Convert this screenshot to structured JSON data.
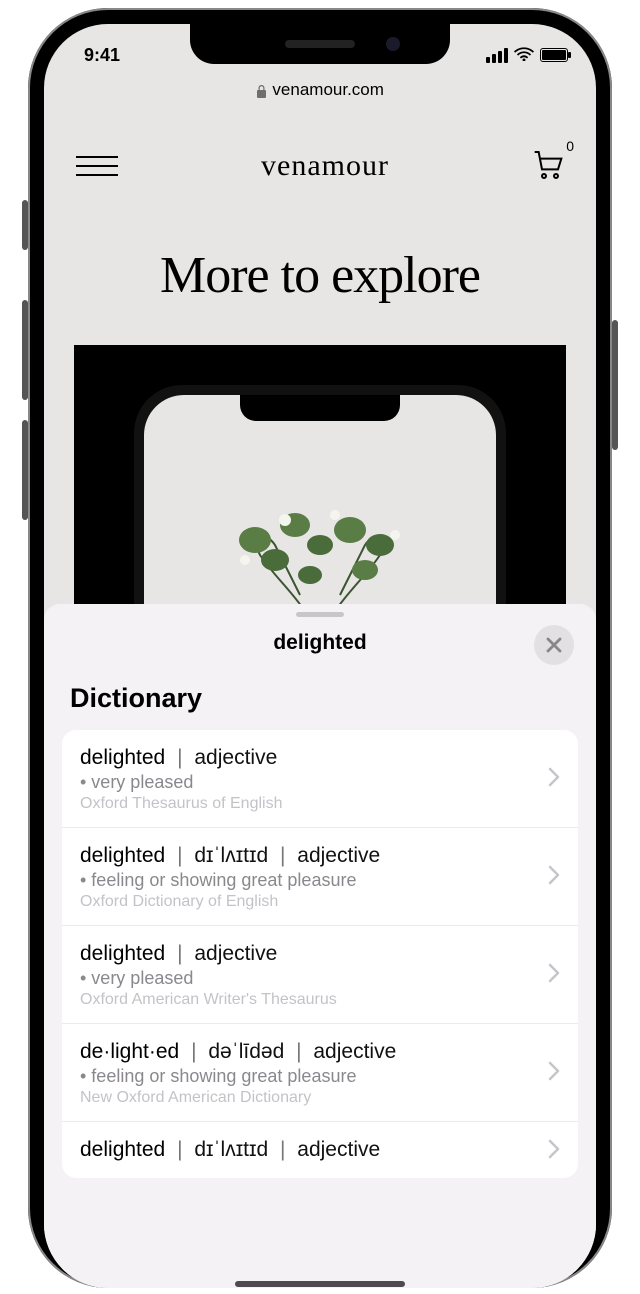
{
  "status": {
    "time": "9:41"
  },
  "browser": {
    "domain": "venamour.com"
  },
  "site": {
    "brand": "venamour",
    "cart_count": "0",
    "heading": "More to explore"
  },
  "sheet": {
    "title": "delighted",
    "section": "Dictionary",
    "entries": [
      {
        "word": "delighted",
        "pron": "",
        "pos": "adjective",
        "def": "• very pleased",
        "src": "Oxford Thesaurus of English"
      },
      {
        "word": "delighted",
        "pron": "dɪˈlʌɪtɪd",
        "pos": "adjective",
        "def": "• feeling or showing great pleasure",
        "src": "Oxford Dictionary of English"
      },
      {
        "word": "delighted",
        "pron": "",
        "pos": "adjective",
        "def": "• very pleased",
        "src": "Oxford American Writer's Thesaurus"
      },
      {
        "word": "de·light·ed",
        "pron": "dəˈlīdəd",
        "pos": "adjective",
        "def": "• feeling or showing great pleasure",
        "src": "New Oxford American Dictionary"
      },
      {
        "word": "delighted",
        "pron": "dɪˈlʌɪtɪd",
        "pos": "adjective",
        "def": "",
        "src": ""
      }
    ]
  }
}
